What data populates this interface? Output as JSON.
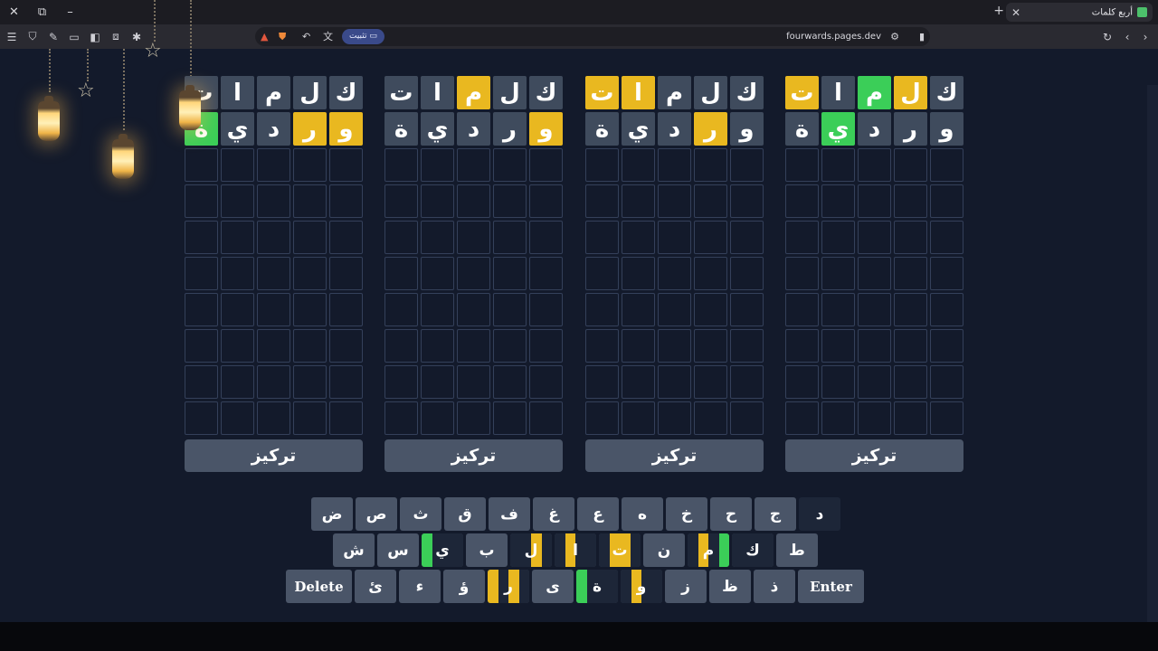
{
  "browser": {
    "tab_title": "أربع كلمات",
    "new_tab": "+",
    "url": "fourwards.pages.dev",
    "pin_label": "تثبيت",
    "window_controls": [
      "✕",
      "⧉",
      "–"
    ]
  },
  "boards": [
    {
      "rows": [
        [
          {
            "l": "ت",
            "s": "yellow"
          },
          {
            "l": "ا",
            "s": "grey"
          },
          {
            "l": "م",
            "s": "green"
          },
          {
            "l": "ل",
            "s": "yellow"
          },
          {
            "l": "ك",
            "s": "grey"
          }
        ],
        [
          {
            "l": "ة",
            "s": "grey"
          },
          {
            "l": "ي",
            "s": "green"
          },
          {
            "l": "د",
            "s": "grey"
          },
          {
            "l": "ر",
            "s": "grey"
          },
          {
            "l": "و",
            "s": "grey"
          }
        ]
      ],
      "focus_label": "تركيز"
    },
    {
      "rows": [
        [
          {
            "l": "ت",
            "s": "yellow"
          },
          {
            "l": "ا",
            "s": "yellow"
          },
          {
            "l": "م",
            "s": "grey"
          },
          {
            "l": "ل",
            "s": "grey"
          },
          {
            "l": "ك",
            "s": "grey"
          }
        ],
        [
          {
            "l": "ة",
            "s": "grey"
          },
          {
            "l": "ي",
            "s": "grey"
          },
          {
            "l": "د",
            "s": "grey"
          },
          {
            "l": "ر",
            "s": "yellow"
          },
          {
            "l": "و",
            "s": "grey"
          }
        ]
      ],
      "focus_label": "تركيز"
    },
    {
      "rows": [
        [
          {
            "l": "ت",
            "s": "grey"
          },
          {
            "l": "ا",
            "s": "grey"
          },
          {
            "l": "م",
            "s": "yellow"
          },
          {
            "l": "ل",
            "s": "grey"
          },
          {
            "l": "ك",
            "s": "grey"
          }
        ],
        [
          {
            "l": "ة",
            "s": "grey"
          },
          {
            "l": "ي",
            "s": "grey"
          },
          {
            "l": "د",
            "s": "grey"
          },
          {
            "l": "ر",
            "s": "grey"
          },
          {
            "l": "و",
            "s": "yellow"
          }
        ]
      ],
      "focus_label": "تركيز"
    },
    {
      "rows": [
        [
          {
            "l": "ت",
            "s": "grey"
          },
          {
            "l": "ا",
            "s": "grey"
          },
          {
            "l": "م",
            "s": "grey"
          },
          {
            "l": "ل",
            "s": "grey"
          },
          {
            "l": "ك",
            "s": "grey"
          }
        ],
        [
          {
            "l": "ة",
            "s": "green"
          },
          {
            "l": "ي",
            "s": "grey"
          },
          {
            "l": "د",
            "s": "grey"
          },
          {
            "l": "ر",
            "s": "yellow"
          },
          {
            "l": "و",
            "s": "yellow"
          }
        ]
      ],
      "focus_label": "تركيز"
    }
  ],
  "keyboard": {
    "rows": [
      [
        {
          "l": "د"
        },
        {
          "l": "ج"
        },
        {
          "l": "ح"
        },
        {
          "l": "خ"
        },
        {
          "l": "ه"
        },
        {
          "l": "ع"
        },
        {
          "l": "غ"
        },
        {
          "l": "ف"
        },
        {
          "l": "ق"
        },
        {
          "l": "ث"
        },
        {
          "l": "ص"
        },
        {
          "l": "ض"
        }
      ],
      [
        {
          "l": "ط"
        },
        {
          "l": "ك",
          "q": [
            "",
            "",
            "",
            ""
          ]
        },
        {
          "l": "م",
          "q": [
            "green",
            "",
            "yellow",
            ""
          ]
        },
        {
          "l": "ن"
        },
        {
          "l": "ت",
          "q": [
            "",
            "yellow",
            "yellow",
            ""
          ]
        },
        {
          "l": "ا",
          "q": [
            "",
            "",
            "yellow",
            ""
          ]
        },
        {
          "l": "ل",
          "q": [
            "",
            "yellow",
            "",
            ""
          ]
        },
        {
          "l": "ب"
        },
        {
          "l": "ي",
          "q": [
            "",
            "",
            "",
            "green"
          ]
        },
        {
          "l": "س"
        },
        {
          "l": "ش"
        }
      ],
      [
        {
          "l": "Enter"
        },
        {
          "l": "ذ"
        },
        {
          "l": "ظ"
        },
        {
          "l": "ز"
        },
        {
          "l": "و",
          "q": [
            "",
            "",
            "yellow",
            ""
          ]
        },
        {
          "l": "ة",
          "q": [
            "",
            "",
            "",
            "green"
          ]
        },
        {
          "l": "ى"
        },
        {
          "l": "ر",
          "q": [
            "",
            "yellow",
            "",
            "yellow"
          ]
        },
        {
          "l": "ؤ"
        },
        {
          "l": "ء"
        },
        {
          "l": "ئ"
        },
        {
          "l": "Delete"
        }
      ]
    ]
  },
  "colors": {
    "green": "#3bce58",
    "yellow": "#e9b820",
    "grey": "#3f4b5d",
    "key": "#4a5568",
    "background": "#131a2b"
  }
}
